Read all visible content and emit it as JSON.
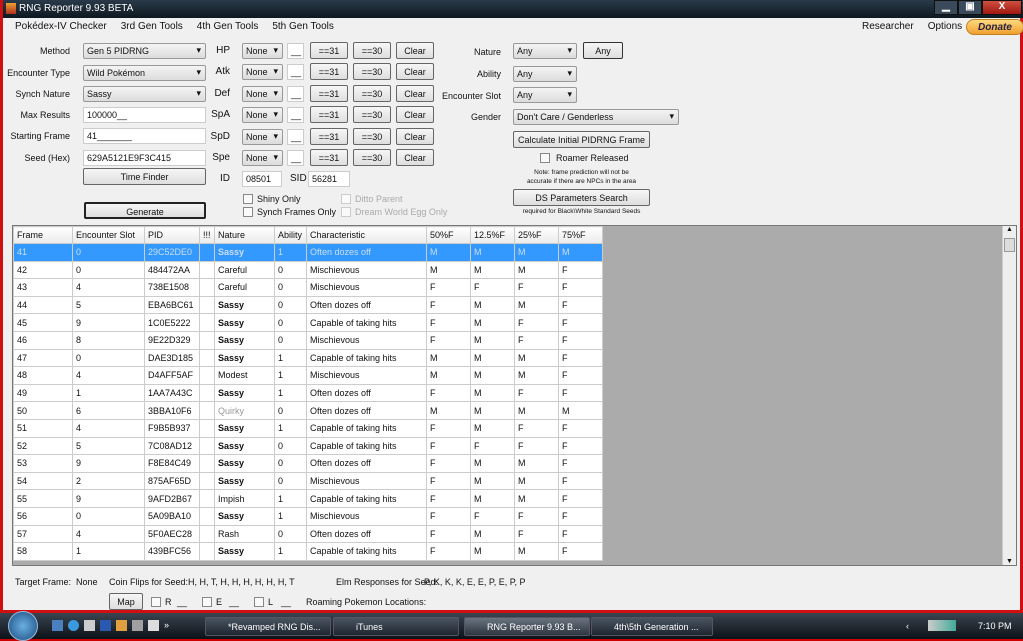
{
  "window": {
    "title": "RNG Reporter 9.93 BETA",
    "min": "▁",
    "max": "▣",
    "close": "X"
  },
  "menu": [
    "Pokédex-IV Checker",
    "3rd Gen Tools",
    "4th Gen Tools",
    "5th Gen Tools"
  ],
  "menu_right": [
    "Researcher",
    "Options"
  ],
  "donate": "Donate",
  "form": {
    "method_label": "Method",
    "method": "Gen 5 PIDRNG",
    "encounter_label": "Encounter Type",
    "encounter": "Wild Pokémon",
    "synch_label": "Synch Nature",
    "synch": "Sassy",
    "max_label": "Max Results",
    "max": "100000__",
    "start_label": "Starting Frame",
    "start": "41_______",
    "seed_label": "Seed (Hex)",
    "seed": "629A5121E9F3C415",
    "time_finder": "Time Finder",
    "generate": "Generate",
    "ivs": [
      {
        "stat": "HP"
      },
      {
        "stat": "Atk"
      },
      {
        "stat": "Def"
      },
      {
        "stat": "SpA"
      },
      {
        "stat": "SpD"
      },
      {
        "stat": "Spe"
      }
    ],
    "iv_select": "None",
    "iv_value": "__",
    "eq31": "==31",
    "eq30": "==30",
    "clear": "Clear",
    "id_label": "ID",
    "id": "08501",
    "sid_label": "SID",
    "sid": "56281",
    "shiny_only": "Shiny Only",
    "synch_only": "Synch Frames Only",
    "ditto": "Ditto Parent",
    "dream": "Dream World Egg Only",
    "nature_label": "Nature",
    "nature": "Any",
    "nature_btn": "Any",
    "ability_label": "Ability",
    "ability": "Any",
    "slot_label": "Encounter Slot",
    "slot": "Any",
    "gender_label": "Gender",
    "gender": "Don't Care / Genderless",
    "calc": "Calculate Initial PIDRNG Frame",
    "roamer": "Roamer Released",
    "note1": "Note: frame prediction will not be",
    "note2": "accurate if there are NPCs in the area",
    "ds": "DS Parameters Search",
    "ds_note": "required for Black\\White Standard Seeds"
  },
  "table": {
    "headers": [
      "Frame",
      "Encounter Slot",
      "PID",
      "!!!",
      "Nature",
      "Ability",
      "Characteristic",
      "50%F",
      "12.5%F",
      "25%F",
      "75%F"
    ],
    "rows": [
      [
        "41",
        "0",
        "29C52DE0",
        "",
        "Sassy",
        "1",
        "Often dozes off",
        "M",
        "M",
        "M",
        "M"
      ],
      [
        "42",
        "0",
        "484472AA",
        "",
        "Careful",
        "0",
        "Mischievous",
        "M",
        "M",
        "M",
        "F"
      ],
      [
        "43",
        "4",
        "738E1508",
        "",
        "Careful",
        "0",
        "Mischievous",
        "F",
        "F",
        "F",
        "F"
      ],
      [
        "44",
        "5",
        "EBA6BC61",
        "",
        "Sassy",
        "0",
        "Often dozes off",
        "F",
        "M",
        "M",
        "F"
      ],
      [
        "45",
        "9",
        "1C0E5222",
        "",
        "Sassy",
        "0",
        "Capable of taking hits",
        "F",
        "M",
        "F",
        "F"
      ],
      [
        "46",
        "8",
        "9E22D329",
        "",
        "Sassy",
        "0",
        "Mischievous",
        "F",
        "M",
        "F",
        "F"
      ],
      [
        "47",
        "0",
        "DAE3D185",
        "",
        "Sassy",
        "1",
        "Capable of taking hits",
        "M",
        "M",
        "M",
        "F"
      ],
      [
        "48",
        "4",
        "D4AFF5AF",
        "",
        "Modest",
        "1",
        "Mischievous",
        "M",
        "M",
        "M",
        "F"
      ],
      [
        "49",
        "1",
        "1AA7A43C",
        "",
        "Sassy",
        "1",
        "Often dozes off",
        "F",
        "M",
        "F",
        "F"
      ],
      [
        "50",
        "6",
        "3BBA10F6",
        "",
        "Quirky",
        "0",
        "Often dozes off",
        "M",
        "M",
        "M",
        "M"
      ],
      [
        "51",
        "4",
        "F9B5B937",
        "",
        "Sassy",
        "1",
        "Capable of taking hits",
        "F",
        "M",
        "F",
        "F"
      ],
      [
        "52",
        "5",
        "7C08AD12",
        "",
        "Sassy",
        "0",
        "Capable of taking hits",
        "F",
        "F",
        "F",
        "F"
      ],
      [
        "53",
        "9",
        "F8E84C49",
        "",
        "Sassy",
        "0",
        "Often dozes off",
        "F",
        "M",
        "M",
        "F"
      ],
      [
        "54",
        "2",
        "875AF65D",
        "",
        "Sassy",
        "0",
        "Mischievous",
        "F",
        "M",
        "M",
        "F"
      ],
      [
        "55",
        "9",
        "9AFD2B67",
        "",
        "Impish",
        "1",
        "Capable of taking hits",
        "F",
        "M",
        "M",
        "F"
      ],
      [
        "56",
        "0",
        "5A09BA10",
        "",
        "Sassy",
        "1",
        "Mischievous",
        "F",
        "F",
        "F",
        "F"
      ],
      [
        "57",
        "4",
        "5F0AEC28",
        "",
        "Rash",
        "0",
        "Often dozes off",
        "F",
        "M",
        "F",
        "F"
      ],
      [
        "58",
        "1",
        "439BFC56",
        "",
        "Sassy",
        "1",
        "Capable of taking hits",
        "F",
        "M",
        "M",
        "F"
      ]
    ]
  },
  "footer": {
    "target_label": "Target Frame:",
    "target": "None",
    "coin_label": "Coin Flips for Seed:",
    "coin": "H, H, T, H, H, H, H, H, H, T",
    "elm_label": "Elm Responses for Seed:",
    "elm": "P, K, K, K, E, E, P, E, P, P",
    "map": "Map",
    "r": "R",
    "e": "E",
    "l": "L",
    "blank": "__",
    "roaming": "Roaming Pokemon Locations:"
  },
  "taskbar": {
    "items": [
      "*Revamped RNG Dis...",
      "iTunes",
      "RNG Reporter 9.93 B...",
      "4th\\5th Generation ..."
    ],
    "clock": "7:10 PM",
    "chevron": "»",
    "tray_arrow": "‹"
  }
}
